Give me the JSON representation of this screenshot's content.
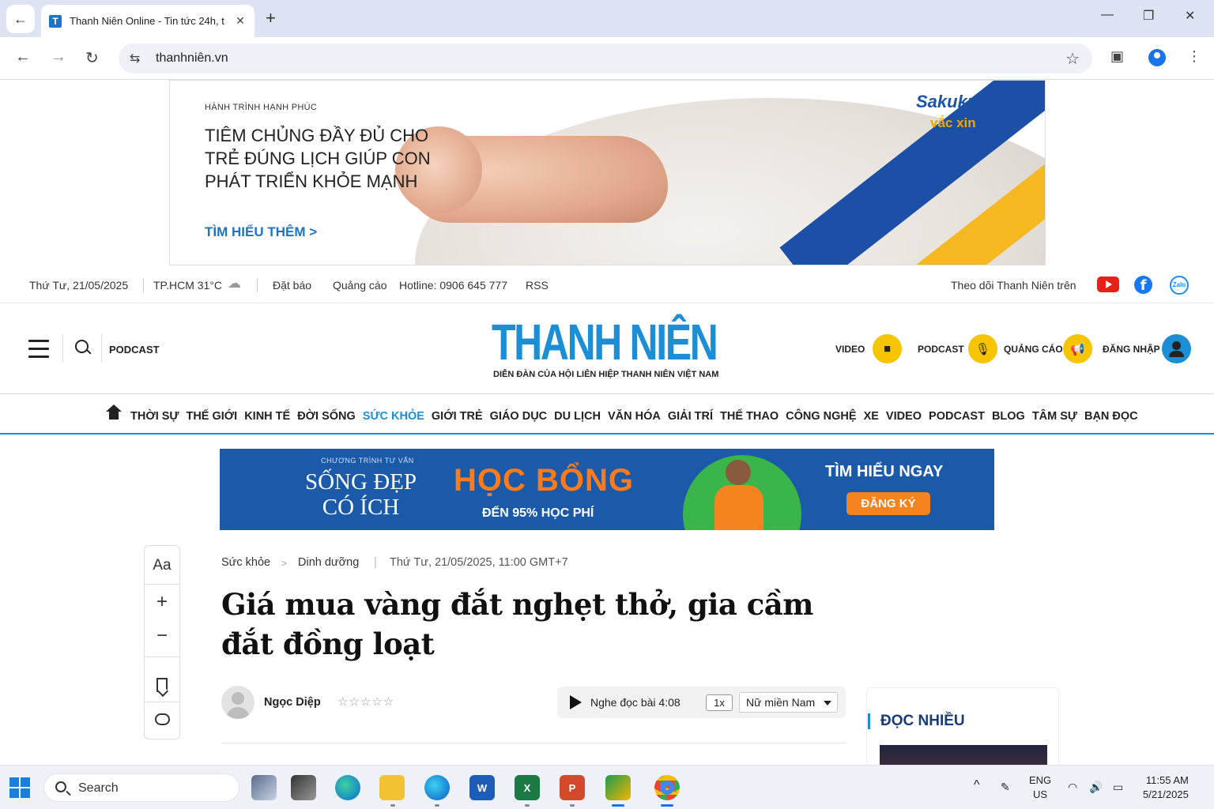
{
  "browser": {
    "tab_title": "Thanh Niên Online - Tin tức 24h, t",
    "favicon_letter": "T",
    "url": "thanhniên.vn",
    "new_tab": "+",
    "minimize": "—",
    "restore": "❐",
    "close": "✕",
    "back": "←",
    "forward": "→",
    "reload": "↻",
    "star": "☆",
    "tab_close": "✕",
    "menu": "⋮",
    "tune": "⇆",
    "sidepanel": "▣"
  },
  "top_ad": {
    "kicker": "HÀNH TRÌNH HẠNH PHÚC",
    "headline": "TIÊM CHỦNG ĐẦY ĐỦ CHO TRẺ ĐÚNG LỊCH GIÚP CON PHÁT TRIỂN KHỎE MẠNH",
    "cta": "TÌM HIỂU THÊM >",
    "brand": "Sakuku",
    "brand_sub": "vắc xin"
  },
  "utility": {
    "date": "Thứ Tư, 21/05/2025",
    "weather": "TP.HCM 31°C",
    "weather_icon": "☁",
    "subscribe": "Đặt báo",
    "ads": "Quảng cáo",
    "hotline": "Hotline: 0906 645 777",
    "rss": "RSS",
    "follow": "Theo dõi Thanh Niên trên",
    "fb_letter": "f",
    "zalo_label": "Zalo"
  },
  "header": {
    "podcast": "PODCAST",
    "logo": "THANH NIÊN",
    "tagline": "DIỄN ĐÀN CỦA HỘI LIÊN HIỆP THANH NIÊN VIỆT NAM",
    "actions": {
      "video": "VIDEO",
      "video_icon": "■",
      "podcast": "PODCAST",
      "podcast_icon": "🎙",
      "ads": "QUẢNG CÁO",
      "ads_icon": "📢",
      "login": "ĐĂNG NHẬP"
    }
  },
  "categories": [
    "THỜI SỰ",
    "THẾ GIỚI",
    "KINH TẾ",
    "ĐỜI SỐNG",
    "SỨC KHỎE",
    "GIỚI TRẺ",
    "GIÁO DỤC",
    "DU LỊCH",
    "VĂN HÓA",
    "GIẢI TRÍ",
    "THỂ THAO",
    "CÔNG NGHỆ",
    "XE",
    "VIDEO",
    "PODCAST",
    "BLOG",
    "TÂM SỰ",
    "BẠN ĐỌC"
  ],
  "active_category": "SỨC KHỎE",
  "banner": {
    "small": "CHƯƠNG TRÌNH TƯ VẤN",
    "line1": "SỐNG ĐẸP",
    "line2": "CÓ ÍCH",
    "scholarship": "HỌC BỔNG",
    "sub": "ĐẾN 95% HỌC PHÍ",
    "cta": "TÌM HIỂU NGAY",
    "register": "ĐĂNG KÝ"
  },
  "rail": {
    "font": "Aa",
    "plus": "+",
    "minus": "−"
  },
  "article": {
    "section": "Sức khỏe",
    "subsection": "Dinh dưỡng",
    "bc_sep": ">",
    "datetime": "Thứ Tư, 21/05/2025, 11:00 GMT+7",
    "title": "Giá mua vàng đắt nghẹt thở, gia cầm đắt đồng loạt",
    "author": "Ngọc Diệp",
    "stars": "☆☆☆☆☆",
    "listen": "Nghe đọc bài",
    "duration": "4:08",
    "speed": "1x",
    "voice": "Nữ miền Nam"
  },
  "sidebar": {
    "most_read": "ĐỌC NHIỀU"
  },
  "taskbar": {
    "search": "Search",
    "lang1": "ENG",
    "lang2": "US",
    "time": "11:55 AM",
    "date": "5/21/2025",
    "chevron": "^",
    "wifi": "◠",
    "volume": "🔊",
    "battery": "▭",
    "pen": "✎",
    "apps": {
      "word": "W",
      "excel": "X",
      "ppt": "P"
    }
  }
}
